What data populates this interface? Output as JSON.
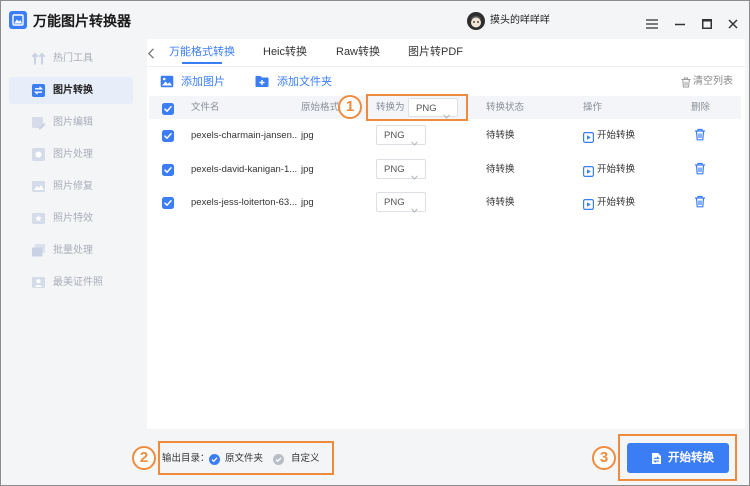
{
  "app": {
    "title": "万能图片转换器",
    "icon": "app-logo-icon"
  },
  "user": {
    "name": "摸头的咩咩咩",
    "avatar_icon": "avatar"
  },
  "window_controls": {
    "icons": [
      "menu-icon",
      "minimize-icon",
      "maximize-icon",
      "close-icon"
    ]
  },
  "sidebar": {
    "items": [
      {
        "label": "热门工具",
        "icon": "hot-tools-icon",
        "active": false
      },
      {
        "label": "图片转换",
        "icon": "image-convert-icon",
        "active": true
      },
      {
        "label": "图片编辑",
        "icon": "image-edit-icon",
        "active": false
      },
      {
        "label": "图片处理",
        "icon": "image-process-icon",
        "active": false
      },
      {
        "label": "照片修复",
        "icon": "photo-repair-icon",
        "active": false
      },
      {
        "label": "照片特效",
        "icon": "photo-effect-icon",
        "active": false
      },
      {
        "label": "批量处理",
        "icon": "batch-icon",
        "active": false
      },
      {
        "label": "最美证件照",
        "icon": "id-photo-icon",
        "active": false
      }
    ]
  },
  "tabs": {
    "back_icon": "chevron-left-icon",
    "items": [
      {
        "label": "万能格式转换",
        "active": true
      },
      {
        "label": "Heic转换",
        "active": false
      },
      {
        "label": "Raw转换",
        "active": false
      },
      {
        "label": "图片转PDF",
        "active": false
      }
    ]
  },
  "toolbar": {
    "add_image": {
      "label": "添加图片",
      "icon": "image-icon"
    },
    "add_folder": {
      "label": "添加文件夹",
      "icon": "folder-add-icon"
    },
    "clear_list": {
      "label": "清空列表",
      "icon": "trash-icon"
    }
  },
  "table": {
    "select_all": true,
    "headers": {
      "filename": "文件名",
      "original_format": "原始格式",
      "convert_to": "转换为",
      "convert_to_value": "PNG",
      "status": "转换状态",
      "action": "操作",
      "delete": "删除"
    },
    "rows": [
      {
        "checked": true,
        "filename": "pexels-charmain-jansen...",
        "format": "jpg",
        "target": "PNG",
        "status": "待转换",
        "action": "开始转换"
      },
      {
        "checked": true,
        "filename": "pexels-david-kanigan-1...",
        "format": "jpg",
        "target": "PNG",
        "status": "待转换",
        "action": "开始转换"
      },
      {
        "checked": true,
        "filename": "pexels-jess-loiterton-63...",
        "format": "jpg",
        "target": "PNG",
        "status": "待转换",
        "action": "开始转换"
      }
    ]
  },
  "footer": {
    "output_label": "输出目录：",
    "options": [
      {
        "label": "原文件夹",
        "selected": true
      },
      {
        "label": "自定义",
        "selected": false
      }
    ],
    "start_button": {
      "label": "开始转换",
      "icon": "convert-file-icon"
    }
  },
  "callouts": [
    "1",
    "2",
    "3"
  ],
  "colors": {
    "accent": "#3b7df5",
    "callout": "#ee8b3d",
    "text": "#222222",
    "muted": "#a8aeb7",
    "header_bg": "#f3f5f8"
  }
}
